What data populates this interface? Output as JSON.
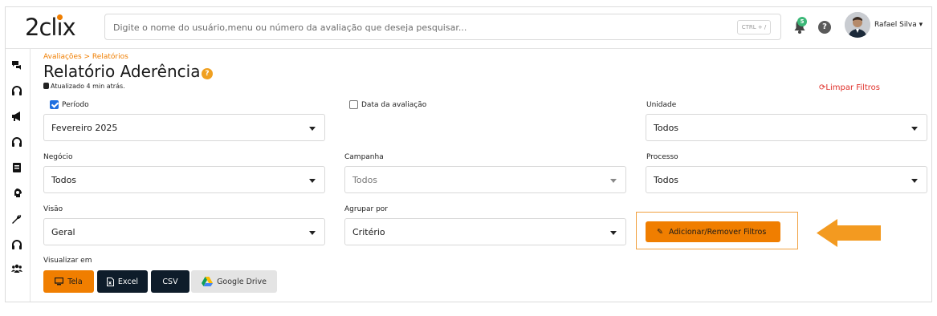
{
  "app": {
    "logo": "2clix",
    "search_placeholder": "Digite o nome do usuário,menu ou número da avaliação que deseja pesquisar...",
    "search_shortcut": "CTRL + /",
    "notifications_count": "5",
    "help_label": "?",
    "user_name": "Rafael Silva"
  },
  "sidebar": {
    "icons": [
      "chat-icon",
      "headset-icon",
      "megaphone-icon",
      "headset-icon",
      "book-icon",
      "brain-icon",
      "wrench-icon",
      "headset-icon",
      "users-icon"
    ]
  },
  "breadcrumb": "Avaliações  >  Relatórios",
  "page": {
    "title": "Relatório Aderência",
    "title_help": "?",
    "updated": "Atualizado 4 min atrás.",
    "clear_filters": "Limpar Filtros"
  },
  "filters": {
    "periodo_label": "Período",
    "periodo_checked": true,
    "periodo_value": "Fevereiro 2025",
    "data_avaliacao_label": "Data da avaliação",
    "data_avaliacao_checked": false,
    "unidade_label": "Unidade",
    "unidade_value": "Todos",
    "negocio_label": "Negócio",
    "negocio_value": "Todos",
    "campanha_label": "Campanha",
    "campanha_value": "Todos",
    "processo_label": "Processo",
    "processo_value": "Todos",
    "visao_label": "Visão",
    "visao_value": "Geral",
    "agrupar_label": "Agrupar por",
    "agrupar_value": "Critério",
    "add_remove_button": "Adicionar/Remover Filtros"
  },
  "view": {
    "label": "Visualizar em",
    "buttons": {
      "tela": "Tela",
      "excel": "Excel",
      "csv": "CSV",
      "gdrive": "Google Drive"
    }
  },
  "colors": {
    "accent": "#f07e00",
    "dark_button": "#0e1c2a",
    "danger": "#e0302a",
    "checkbox": "#1e6fe0"
  }
}
